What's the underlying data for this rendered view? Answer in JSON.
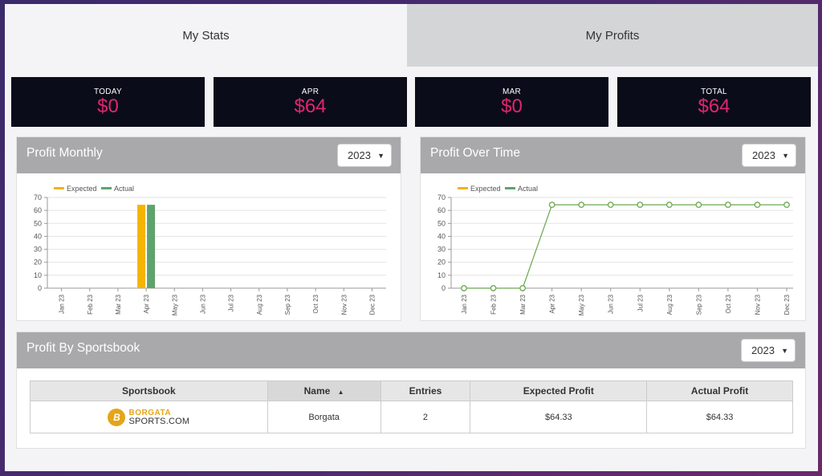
{
  "tabs": [
    {
      "label": "My Stats",
      "active": true
    },
    {
      "label": "My Profits",
      "active": false
    }
  ],
  "stats": [
    {
      "label": "TODAY",
      "value": "$0"
    },
    {
      "label": "APR",
      "value": "$64"
    },
    {
      "label": "MAR",
      "value": "$0"
    },
    {
      "label": "TOTAL",
      "value": "$64"
    }
  ],
  "colors": {
    "accent": "#e0266e",
    "expected": "#f5b400",
    "actual": "#5fa36c",
    "line": "#6aa84f"
  },
  "profit_monthly": {
    "title": "Profit Monthly",
    "year": "2023",
    "legend": {
      "expected": "Expected",
      "actual": "Actual"
    }
  },
  "profit_over_time": {
    "title": "Profit Over Time",
    "year": "2023",
    "legend": {
      "expected": "Expected",
      "actual": "Actual"
    }
  },
  "sportsbook_panel": {
    "title": "Profit By Sportsbook",
    "year": "2023",
    "columns": [
      "Sportsbook",
      "Name",
      "Entries",
      "Expected Profit",
      "Actual Profit"
    ],
    "sort_indicator": "▲",
    "rows": [
      {
        "logo_line1": "BORGATA",
        "logo_line2": "SPORTS.COM",
        "logo_glyph": "B",
        "name": "Borgata",
        "entries": "2",
        "expected": "$64.33",
        "actual": "$64.33"
      }
    ]
  },
  "chart_data": [
    {
      "type": "bar",
      "categories": [
        "Jan 23",
        "Feb 23",
        "Mar 23",
        "Apr 23",
        "May 23",
        "Jun 23",
        "Jul 23",
        "Aug 23",
        "Sep 23",
        "Oct 23",
        "Nov 23",
        "Dec 23"
      ],
      "series": [
        {
          "name": "Expected",
          "values": [
            0,
            0,
            0,
            64.33,
            0,
            0,
            0,
            0,
            0,
            0,
            0,
            0
          ]
        },
        {
          "name": "Actual",
          "values": [
            0,
            0,
            0,
            64.33,
            0,
            0,
            0,
            0,
            0,
            0,
            0,
            0
          ]
        }
      ],
      "yticks": [
        0,
        10,
        20,
        30,
        40,
        50,
        60,
        70
      ],
      "ylim": [
        0,
        70
      ],
      "title": "Profit Monthly",
      "legend": "top-left",
      "grid": true
    },
    {
      "type": "line",
      "categories": [
        "Jan 23",
        "Feb 23",
        "Mar 23",
        "Apr 23",
        "May 23",
        "Jun 23",
        "Jul 23",
        "Aug 23",
        "Sep 23",
        "Oct 23",
        "Nov 23",
        "Dec 23"
      ],
      "series": [
        {
          "name": "Actual",
          "values": [
            0,
            0,
            0,
            64.33,
            64.33,
            64.33,
            64.33,
            64.33,
            64.33,
            64.33,
            64.33,
            64.33
          ]
        }
      ],
      "legend_entries": [
        "Expected",
        "Actual"
      ],
      "yticks": [
        0,
        10,
        20,
        30,
        40,
        50,
        60,
        70
      ],
      "ylim": [
        0,
        70
      ],
      "title": "Profit Over Time",
      "legend": "top-left",
      "grid": true
    }
  ]
}
